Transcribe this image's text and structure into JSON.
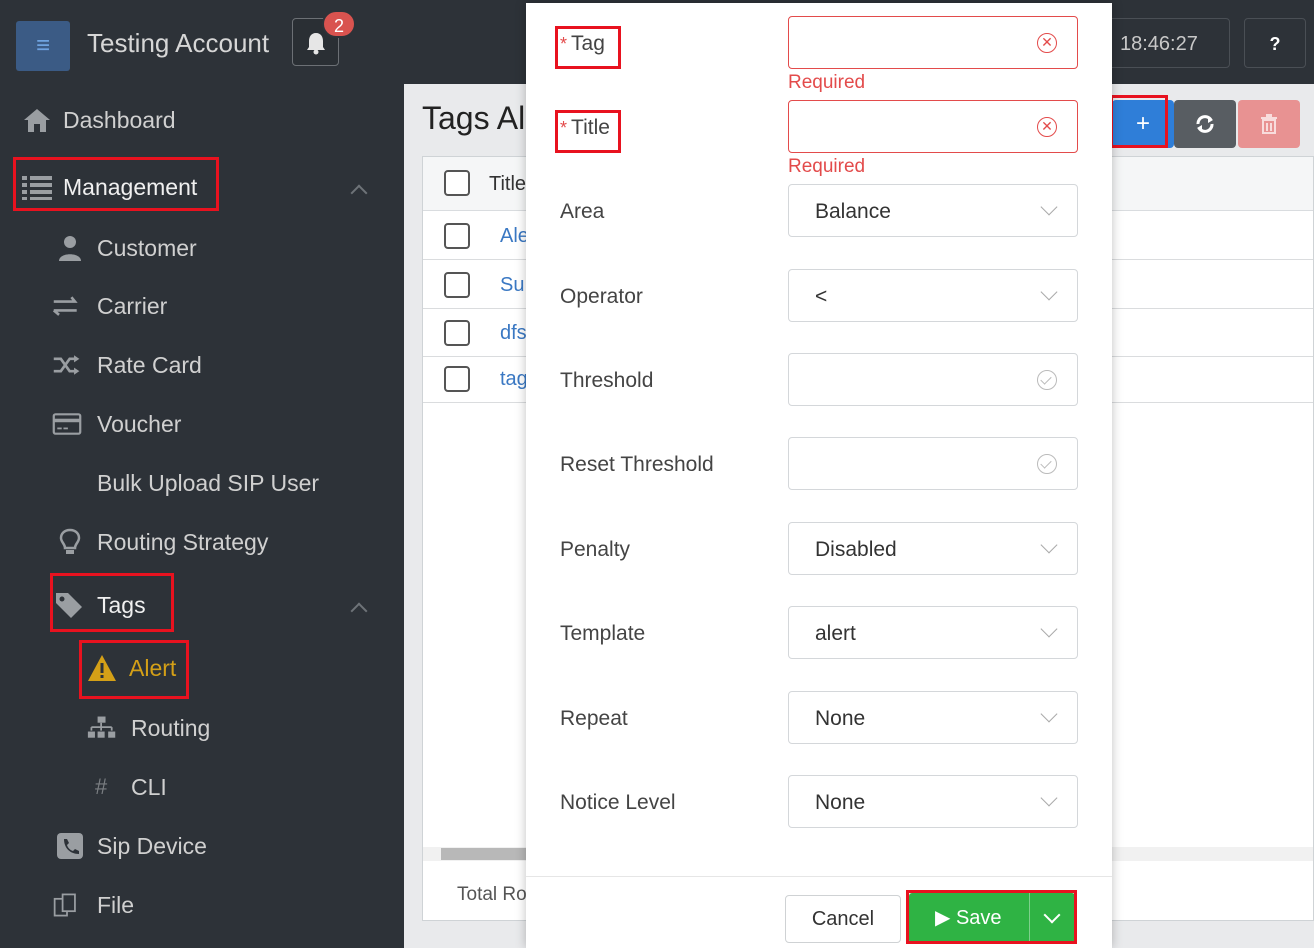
{
  "header": {
    "account_name": "Testing Account",
    "notification_count": "2",
    "clock": "18:46:27",
    "help_label": "?"
  },
  "sidebar": {
    "dashboard": "Dashboard",
    "management": "Management",
    "customer": "Customer",
    "carrier": "Carrier",
    "rate_card": "Rate Card",
    "voucher": "Voucher",
    "bulk_upload": "Bulk Upload SIP User",
    "routing_strategy": "Routing Strategy",
    "tags": "Tags",
    "alert": "Alert",
    "routing": "Routing",
    "cli": "CLI",
    "sip_device": "Sip Device",
    "file": "File"
  },
  "main": {
    "page_title": "Tags Al",
    "column_title": "Title",
    "rows": [
      "Ale",
      "Su",
      "dfs",
      "tag"
    ],
    "footer": "Total Ro"
  },
  "form": {
    "tag_label": "Tag",
    "title_label": "Title",
    "required_mark": "*",
    "required_msg": "Required",
    "area_label": "Area",
    "area_value": "Balance",
    "operator_label": "Operator",
    "operator_value": "<",
    "threshold_label": "Threshold",
    "reset_threshold_label": "Reset Threshold",
    "penalty_label": "Penalty",
    "penalty_value": "Disabled",
    "template_label": "Template",
    "template_value": "alert",
    "repeat_label": "Repeat",
    "repeat_value": "None",
    "notice_level_label": "Notice Level",
    "notice_level_value": "None",
    "cancel_label": "Cancel",
    "save_label": "Save"
  },
  "colors": {
    "sidebar_bg": "#2d3238",
    "highlight": "#e8121f",
    "error": "#e34b4b",
    "save_green": "#2fb344",
    "alert_yellow": "#d4a017",
    "add_blue": "#2f7ed8"
  }
}
